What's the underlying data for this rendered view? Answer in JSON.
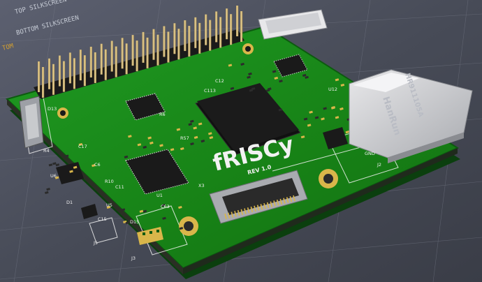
{
  "viewer": {
    "layer_labels": [
      "TOP SILKSCREEN",
      "BOTTOM SILKSCREEN",
      "TOM"
    ]
  },
  "board": {
    "name": "fRISCy",
    "revision": "REV 1.0",
    "jack_brand": "HanRun",
    "jack_model": "HR911105A"
  },
  "refdes": {
    "d13": "D13",
    "r4": "R4",
    "c17": "C17",
    "u6": "U6",
    "c6": "C6",
    "d1": "D1",
    "c15": "C15",
    "u5": "U5",
    "d15": "D15",
    "r10": "R10",
    "c11": "C11",
    "c63": "C63",
    "x3": "X3",
    "u12": "U12",
    "r57": "R57",
    "j2": "J2",
    "j5": "J5",
    "c113": "C113",
    "c12": "C12",
    "r6": "R6",
    "gnd": "GND",
    "j3": "J3",
    "u1": "U1"
  },
  "colors": {
    "pcb": "#1c8a1c",
    "pcb_dark": "#0f5a12",
    "silkscreen": "#f2f2f2",
    "pad_gold": "#d9b64a",
    "layer_text": "#c7ccd6",
    "layer_accent": "#d4a030"
  }
}
